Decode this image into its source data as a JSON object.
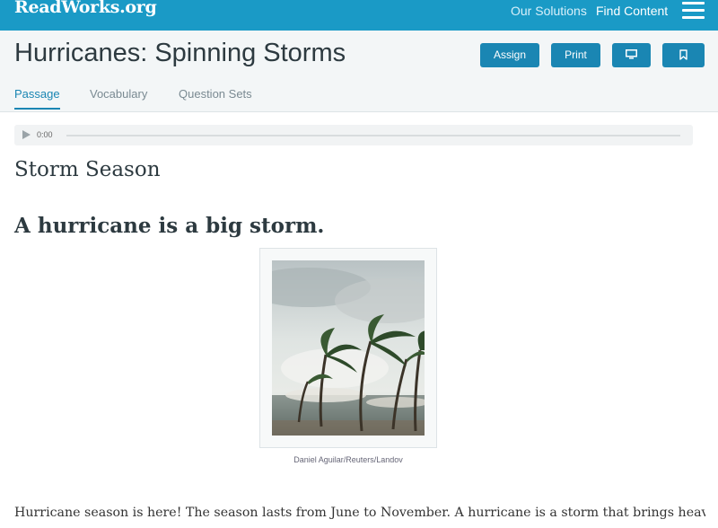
{
  "header": {
    "logo": "ReadWorks.org",
    "nav": [
      "Our Solutions",
      "Find Content"
    ],
    "menu_icon": "hamburger-menu-icon"
  },
  "title_bar": {
    "title": "Hurricanes: Spinning Storms",
    "buttons": {
      "assign": "Assign",
      "print": "Print",
      "present_icon": "monitor-icon",
      "bookmark_icon": "bookmark-icon"
    },
    "tabs": [
      "Passage",
      "Vocabulary",
      "Question Sets"
    ],
    "active_tab": "Passage"
  },
  "audio": {
    "time": "0:00",
    "play_icon": "play-icon"
  },
  "passage": {
    "section_title": "Storm Season",
    "headline": "A hurricane is a big storm.",
    "image_caption": "Daniel Aguilar/Reuters/Landov",
    "paragraph": "Hurricane season is here! The season lasts from June to November. A hurricane is a storm that brings heavy rain"
  },
  "colors": {
    "brand": "#1a9ac6",
    "button": "#1a86b3",
    "title_bar_bg": "#f3f6f7"
  }
}
